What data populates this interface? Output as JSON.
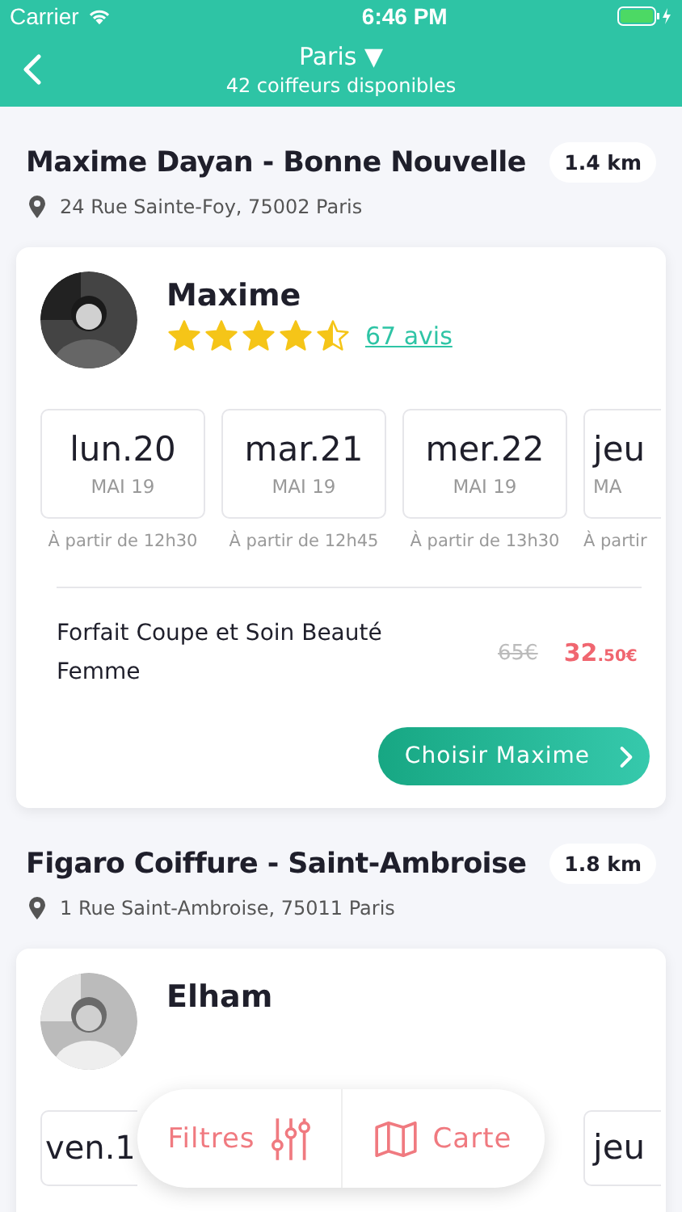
{
  "status_bar": {
    "carrier": "Carrier",
    "time": "6:46 PM"
  },
  "nav": {
    "city": "Paris",
    "caret": "▼",
    "subtitle": "42 coiffeurs disponibles"
  },
  "salons": [
    {
      "name": "Maxime Dayan - Bonne Nouvelle",
      "distance": "1.4 km",
      "address": "24 Rue Sainte-Foy, 75002 Paris",
      "stylist": {
        "name": "Maxime",
        "stars": 4.5,
        "reviews": "67 avis"
      },
      "days": [
        {
          "kind": "full",
          "day": "lun.20",
          "month": "MAI 19",
          "from": "À partir de 12h30"
        },
        {
          "kind": "full",
          "day": "mar.21",
          "month": "MAI 19",
          "from": "À partir de 12h45"
        },
        {
          "kind": "full",
          "day": "mer.22",
          "month": "MAI 19",
          "from": "À partir de 13h30"
        },
        {
          "kind": "cut",
          "day": "jeu",
          "month": "MA",
          "from": "À partir"
        }
      ],
      "service": {
        "name": "Forfait Coupe et Soin Beauté Femme",
        "old_price": "65€",
        "price": "32",
        "price_cents": ".50€"
      },
      "button": "Choisir Maxime"
    },
    {
      "name": "Figaro Coiffure - Saint-Ambroise",
      "distance": "1.8 km",
      "address": "1 Rue Saint-Ambroise, 75011 Paris",
      "stylist": {
        "name": "Elham"
      },
      "days": [
        {
          "kind": "cut",
          "day": "ven.1"
        },
        {
          "kind": "cut",
          "day": "jeu"
        }
      ]
    }
  ],
  "floating_bar": {
    "filters": "Filtres",
    "map": "Carte"
  }
}
